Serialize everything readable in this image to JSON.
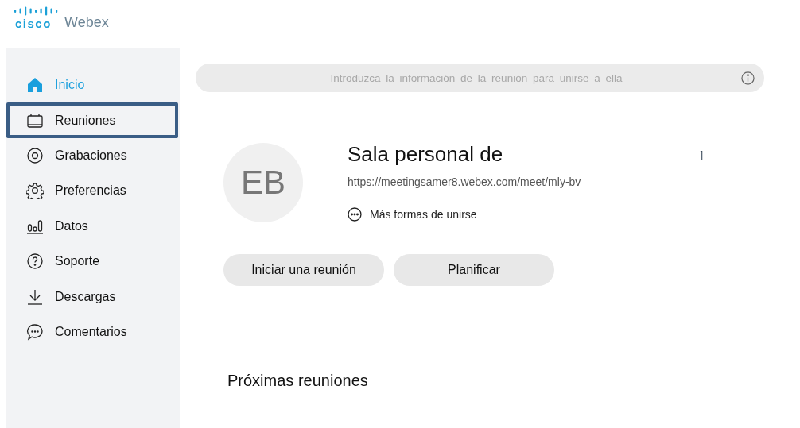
{
  "logo": {
    "brand": "cisco",
    "product": "Webex"
  },
  "sidebar": {
    "items": [
      {
        "label": "Inicio",
        "kind": "home",
        "selected": true,
        "highlighted": false
      },
      {
        "label": "Reuniones",
        "kind": "calendar",
        "selected": false,
        "highlighted": true
      },
      {
        "label": "Grabaciones",
        "kind": "record",
        "selected": false,
        "highlighted": false
      },
      {
        "label": "Preferencias",
        "kind": "gear",
        "selected": false,
        "highlighted": false
      },
      {
        "label": "Datos",
        "kind": "bars",
        "selected": false,
        "highlighted": false
      },
      {
        "label": "Soporte",
        "kind": "help",
        "selected": false,
        "highlighted": false
      },
      {
        "label": "Descargas",
        "kind": "download",
        "selected": false,
        "highlighted": false
      },
      {
        "label": "Comentarios",
        "kind": "comment",
        "selected": false,
        "highlighted": false
      }
    ]
  },
  "search": {
    "placeholder": "Introduzca la información de la reunión para unirse a ella"
  },
  "room": {
    "initials": "EB",
    "title": "Sala personal de",
    "fragment": "]",
    "url": "https://meetingsamer8.webex.com/meet/mly-bv",
    "more": "Más formas de unirse"
  },
  "buttons": [
    "Iniciar una reunión",
    "Planificar"
  ],
  "upcoming": {
    "heading": "Próximas reuniones"
  }
}
